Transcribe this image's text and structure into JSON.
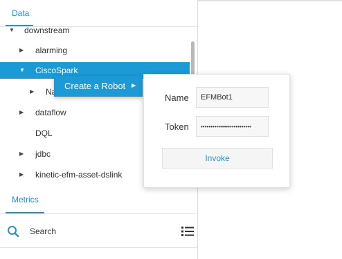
{
  "tabs": {
    "data": "Data",
    "metrics": "Metrics"
  },
  "tree": {
    "items": [
      {
        "label": "downstream",
        "arrow": "▼"
      },
      {
        "label": "alarming",
        "arrow": "▶"
      },
      {
        "label": "CiscoSpark",
        "arrow": "▼"
      },
      {
        "label": "Na",
        "arrow": "▶"
      },
      {
        "label": "dataflow",
        "arrow": "▶"
      },
      {
        "label": "DQL",
        "arrow": ""
      },
      {
        "label": "jdbc",
        "arrow": "▶"
      },
      {
        "label": "kinetic-efm-asset-dslink",
        "arrow": "▶"
      }
    ]
  },
  "context_menu": {
    "label": "Create a Robot",
    "arrow": "▶"
  },
  "dialog": {
    "name_label": "Name",
    "name_value": "EFMBot1",
    "token_label": "Token",
    "token_value": "••••••••••••••••••••••••••",
    "invoke_label": "Invoke"
  },
  "search": {
    "label": "Search"
  },
  "colors": {
    "accent": "#1c9ad6",
    "link": "#2a8fd0"
  },
  "icons": {
    "search": "search-icon",
    "list": "list-icon"
  }
}
